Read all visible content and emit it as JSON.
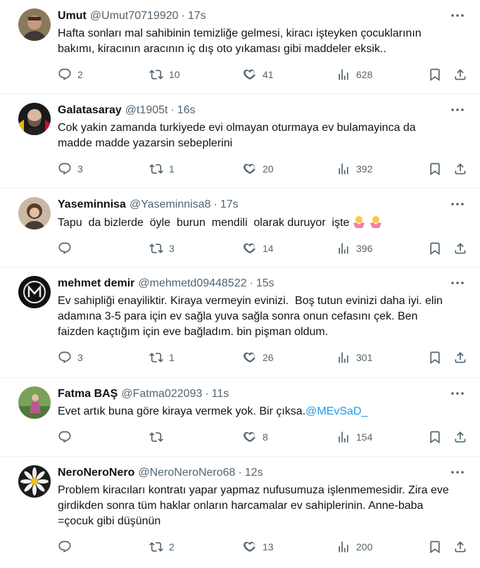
{
  "tweets": [
    {
      "name": "Umut",
      "handle": "@Umut70719920",
      "time": "17s",
      "text": "Hafta sonları mal sahibinin temizliğe gelmesi, kiracı işteyken çocuklarının bakımı, kiracının aracının iç dış oto yıkaması gibi maddeler eksik..",
      "replies": "2",
      "retweets": "10",
      "likes": "41",
      "views": "628"
    },
    {
      "name": "Galatasaray",
      "handle": "@t1905t",
      "time": "16s",
      "text": "Cok yakin zamanda turkiyede evi olmayan oturmaya ev bulamayinca da madde madde yazarsin sebeplerini",
      "replies": "3",
      "retweets": "1",
      "likes": "20",
      "views": "392"
    },
    {
      "name": "Yaseminnisa",
      "handle": "@Yaseminnisa8",
      "time": "17s",
      "text": "Tapu  da bizlerde  öyle  burun  mendili  olarak duruyor  işte",
      "emoji": "🤷‍♀️🤷‍♀️",
      "replies": "",
      "retweets": "3",
      "likes": "14",
      "views": "396"
    },
    {
      "name": "mehmet demir",
      "handle": "@mehmetd09448522",
      "time": "15s",
      "text": "Ev sahipliği enayiliktir. Kiraya vermeyin evinizi.  Boş tutun evinizi daha iyi. elin adamına 3-5 para için ev sağla yuva sağla sonra onun cefasını çek. Ben faizden kaçtığım için eve bağladım. bin pişman oldum.",
      "replies": "3",
      "retweets": "1",
      "likes": "26",
      "views": "301"
    },
    {
      "name": "Fatma BAŞ",
      "handle": "@Fatma022093",
      "time": "11s",
      "text": "Evet artık buna göre kiraya vermek yok. Bir çıksa.",
      "mention": "@MEvSaD_",
      "replies": "",
      "retweets": "",
      "likes": "8",
      "views": "154"
    },
    {
      "name": "NeroNeroNero",
      "handle": "@NeroNeroNero68",
      "time": "12s",
      "text": "Problem kiracıları kontratı yapar yapmaz nufusumuza işlenmemesidir. Zira eve girdikden sonra tüm haklar onların harcamalar ev sahiplerinin. Anne-baba =çocuk gibi düşünün",
      "replies": "",
      "retweets": "2",
      "likes": "13",
      "views": "200"
    }
  ],
  "colors": {
    "text": "#0f1419",
    "secondary": "#536471",
    "link": "#1d9bf0",
    "divider": "#eff3f4"
  },
  "icons": [
    "more-icon",
    "reply-icon",
    "retweet-icon",
    "like-icon",
    "views-icon",
    "bookmark-icon",
    "share-icon"
  ]
}
